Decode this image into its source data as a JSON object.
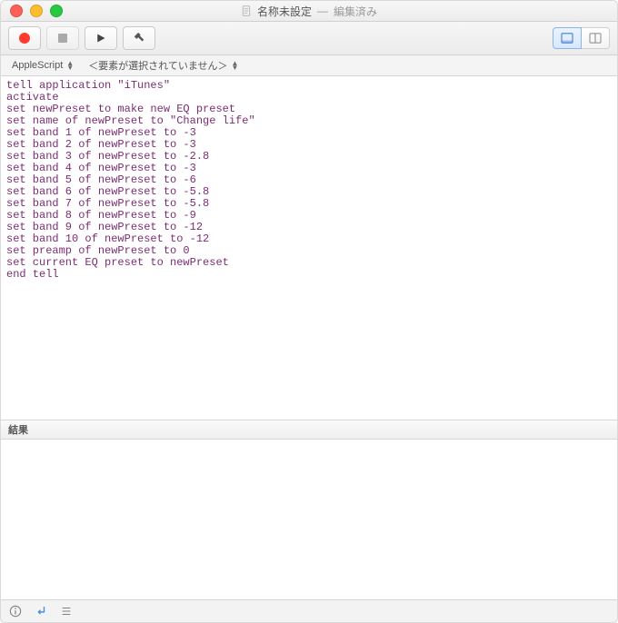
{
  "window": {
    "title": "名称未設定",
    "title_separator": "—",
    "status": "編集済み"
  },
  "toolbar": {
    "record_label": "Record",
    "stop_label": "Stop",
    "run_label": "Run",
    "build_label": "Build"
  },
  "optionbar": {
    "language": "AppleScript",
    "elements": "＜要素が選択されていません＞"
  },
  "code": {
    "lines": [
      "tell application \"iTunes\"",
      "activate",
      "set newPreset to make new EQ preset",
      "set name of newPreset to \"Change life\"",
      "set band 1 of newPreset to -3",
      "set band 2 of newPreset to -3",
      "set band 3 of newPreset to -2.8",
      "set band 4 of newPreset to -3",
      "set band 5 of newPreset to -6",
      "set band 6 of newPreset to -5.8",
      "set band 7 of newPreset to -5.8",
      "set band 8 of newPreset to -9",
      "set band 9 of newPreset to -12",
      "set band 10 of newPreset to -12",
      "set preamp of newPreset to 0",
      "set current EQ preset to newPreset",
      "end tell"
    ]
  },
  "results": {
    "label": "結果"
  }
}
